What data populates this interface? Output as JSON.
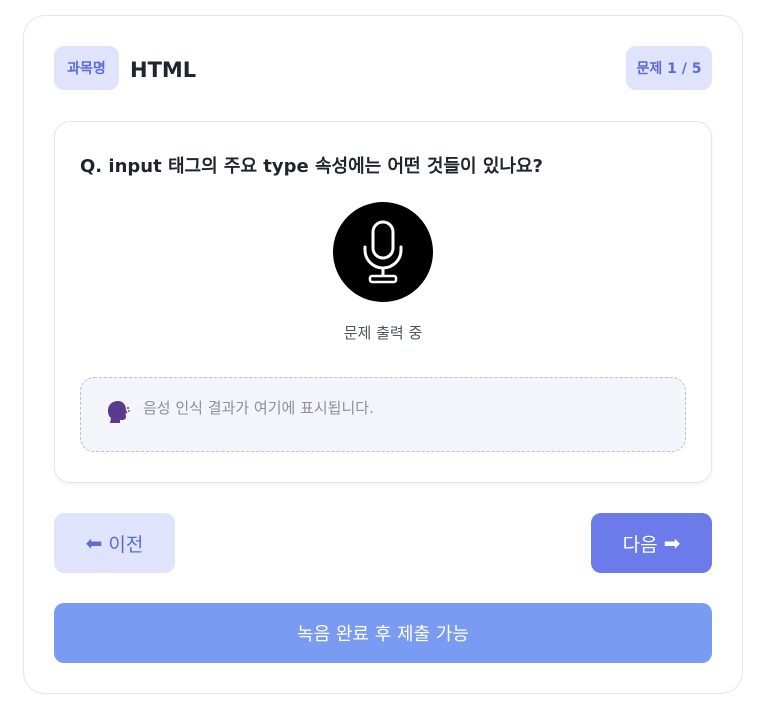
{
  "header": {
    "subject_label": "과목명",
    "subject_name": "HTML",
    "progress": "문제 1 / 5"
  },
  "question": {
    "text": "Q. input 태그의 주요 type 속성에는 어떤 것들이 있나요?",
    "mic_icon": "microphone-icon",
    "mic_status": "문제 출력 중"
  },
  "transcript": {
    "icon": "speaking-head-icon",
    "placeholder": "음성 인식 결과가 여기에 표시됩니다."
  },
  "nav": {
    "prev_label": "이전",
    "prev_icon": "arrow-left-icon",
    "next_label": "다음",
    "next_icon": "arrow-right-icon"
  },
  "submit": {
    "label": "녹음 완료 후 제출 가능"
  },
  "colors": {
    "accent": "#6b7cea",
    "badge_bg": "#dfe3fc",
    "badge_text": "#5b6cd9",
    "submit_bg": "#7a9bf2"
  }
}
